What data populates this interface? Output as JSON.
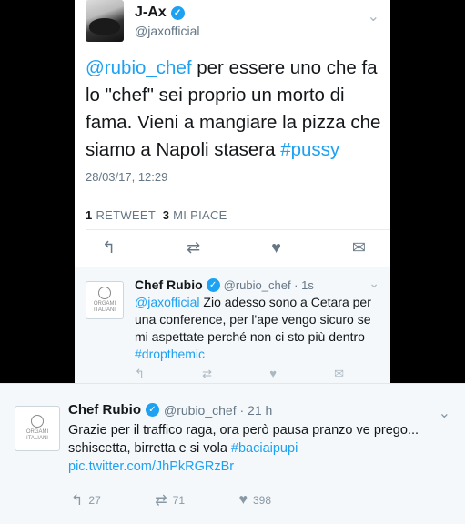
{
  "tweet_main": {
    "author_name": "J-Ax",
    "handle": "@jaxofficial",
    "mention": "@rubio_chef",
    "text_part1": " per essere uno che fa lo \"chef\" sei proprio un morto di fama. Vieni a mangiare la pizza che siamo a Napoli stasera ",
    "hashtag": "#pussy",
    "datetime": "28/03/17, 12:29",
    "retweet_count": "1",
    "retweet_label": "RETWEET",
    "like_count": "3",
    "like_label": "MI PIACE"
  },
  "reply": {
    "author_name": "Chef Rubio",
    "meta": "@rubio_chef · 1s",
    "mention": "@jaxofficial",
    "text": " Zio adesso sono a Cetara per una conference, per l'ape vengo sicuro se mi aspettate perché non ci sto più dentro ",
    "hashtag": "#dropthemic"
  },
  "tweet_bottom": {
    "author_name": "Chef Rubio",
    "meta": "@rubio_chef · 21 h",
    "text": "Grazie per il traffico raga, ora però pausa pranzo ve prego... schiscetta, birretta e si vola ",
    "hashtag": "#baciaipupi",
    "link": "pic.twitter.com/JhPkRGRzBr",
    "reply_count": "27",
    "retweet_count": "71",
    "like_count": "398"
  },
  "logo": {
    "line1": "ORGAMI",
    "line2": "ITALIANI"
  },
  "colors": {
    "link": "#1da1f2",
    "text": "#14171a",
    "muted": "#657786"
  }
}
